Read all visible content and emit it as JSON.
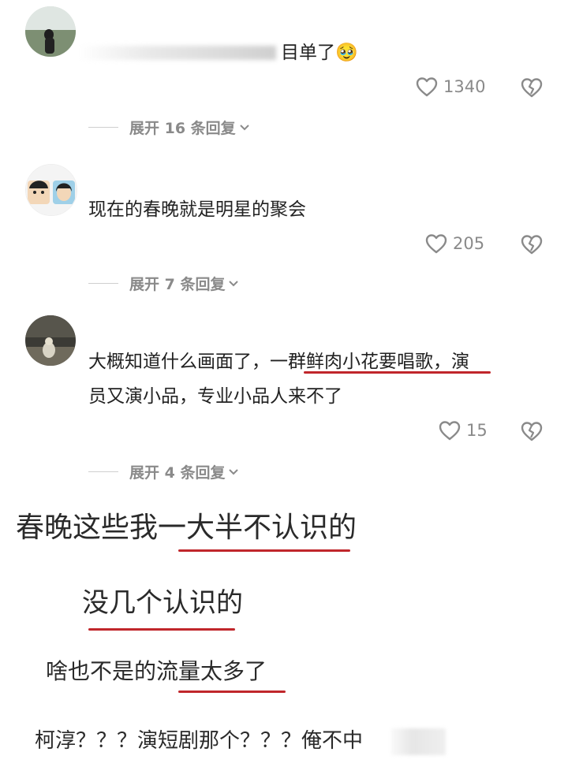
{
  "comments": [
    {
      "text": "目单了",
      "emoji": "🥹",
      "likes": "1340",
      "expand": "展开 16 条回复"
    },
    {
      "text": "现在的春晚就是明星的聚会",
      "likes": "205",
      "expand": "展开 7 条回复"
    },
    {
      "text_line1_a": "大概知道什么画面了，",
      "text_line1_b": "一群鲜肉小花要唱歌",
      "text_line1_c": "，演",
      "text_line2": "员又演小品，专业小品人来不了",
      "likes": "15",
      "expand": "展开 4 条回复"
    }
  ],
  "captions": {
    "c1": "春晚这些我一大半不认识的",
    "c2": "没几个认识的",
    "c3": "啥也不是的流量太多了",
    "c4": "柯淳？？？演短剧那个？？？俺不中"
  },
  "colors": {
    "underline": "#c0262b",
    "meta_text": "#8a8a8a"
  },
  "icons": {
    "like": "heart-outline-icon",
    "dislike": "broken-heart-icon",
    "expand": "chevron-down-icon"
  }
}
